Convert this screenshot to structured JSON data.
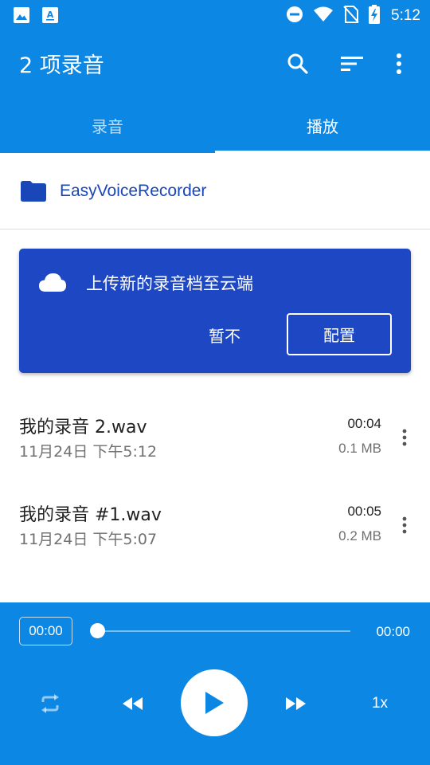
{
  "status_bar": {
    "time": "5:12",
    "left_icons": [
      "image-icon",
      "font-icon"
    ],
    "right_icons": [
      "do-not-disturb-icon",
      "wifi-icon",
      "no-sim-icon",
      "battery-charging-icon"
    ]
  },
  "app_bar": {
    "title": "2 项录音",
    "actions": [
      "search-icon",
      "sort-icon",
      "more-vert-icon"
    ]
  },
  "tabs": [
    {
      "label": "录音",
      "active": false
    },
    {
      "label": "播放",
      "active": true
    }
  ],
  "folder": {
    "name": "EasyVoiceRecorder",
    "icon": "folder-icon"
  },
  "upload_card": {
    "icon": "cloud-icon",
    "message": "上传新的录音档至云端",
    "dismiss_label": "暂不",
    "configure_label": "配置"
  },
  "recordings": [
    {
      "name": "我的录音 2.wav",
      "date": "11月24日 下午5:12",
      "duration": "00:04",
      "size": "0.1 MB"
    },
    {
      "name": "我的录音 #1.wav",
      "date": "11月24日 下午5:07",
      "duration": "00:05",
      "size": "0.2 MB"
    }
  ],
  "player": {
    "current_time": "00:00",
    "total_time": "00:00",
    "progress": 0,
    "speed": "1x",
    "controls": [
      "repeat-icon",
      "rewind-icon",
      "play-icon",
      "fast-forward-icon"
    ]
  },
  "colors": {
    "primary": "#0d87e4",
    "card": "#1e47c4",
    "folder_text": "#1a47b8"
  }
}
